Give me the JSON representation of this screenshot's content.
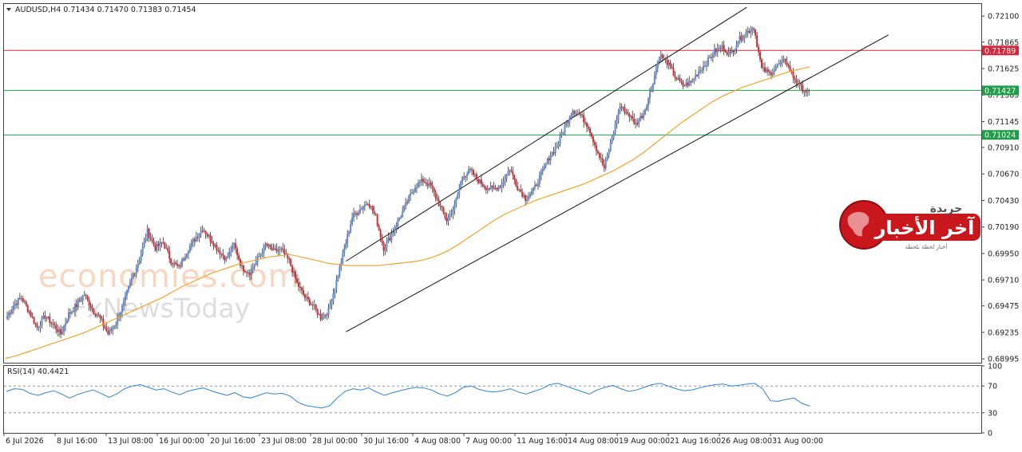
{
  "chart_data": {
    "type": "candlestick",
    "symbol_header": "AUDUSD,H4  0.71434 0.71470 0.71383 0.71454",
    "price_axis": {
      "ticks": [
        "0.72100",
        "0.71865",
        "0.71625",
        "0.71385",
        "0.71145",
        "0.70910",
        "0.70670",
        "0.70430",
        "0.70190",
        "0.69950",
        "0.69710",
        "0.69475",
        "0.69235",
        "0.68995"
      ],
      "range": [
        0.6896,
        0.7221
      ]
    },
    "time_axis": {
      "labels": [
        "6 Jul 2026",
        "8 Jul 16:00",
        "13 Jul 08:00",
        "16 Jul 00:00",
        "20 Jul 16:00",
        "23 Jul 08:00",
        "28 Jul 00:00",
        "30 Jul 16:00",
        "4 Aug 08:00",
        "7 Aug 00:00",
        "11 Aug 16:00",
        "14 Aug 08:00",
        "19 Aug 00:00",
        "21 Aug 16:00",
        "26 Aug 08:00",
        "31 Aug 00:00"
      ]
    },
    "horizontal_levels": [
      {
        "value": "0.71789",
        "color": "#d8263a"
      },
      {
        "value": "0.71427",
        "color": "#1e9e48"
      },
      {
        "value": "0.71024",
        "color": "#1e9e48"
      }
    ],
    "price_path": [
      0.6936,
      0.6948,
      0.6955,
      0.6942,
      0.6928,
      0.6938,
      0.6931,
      0.6922,
      0.694,
      0.6948,
      0.6958,
      0.6944,
      0.6936,
      0.6922,
      0.6932,
      0.695,
      0.6972,
      0.699,
      0.7015,
      0.7,
      0.7005,
      0.6988,
      0.6982,
      0.6997,
      0.7008,
      0.7018,
      0.7008,
      0.6998,
      0.699,
      0.7003,
      0.6982,
      0.6978,
      0.699,
      0.7003,
      0.6997,
      0.6998,
      0.6988,
      0.6968,
      0.6955,
      0.6948,
      0.6937,
      0.6943,
      0.697,
      0.6999,
      0.7028,
      0.7035,
      0.7042,
      0.7028,
      0.7,
      0.7012,
      0.7027,
      0.7042,
      0.7056,
      0.7061,
      0.7056,
      0.704,
      0.7025,
      0.7038,
      0.7065,
      0.707,
      0.7061,
      0.7055,
      0.7053,
      0.7058,
      0.7072,
      0.7055,
      0.7045,
      0.7052,
      0.7067,
      0.7082,
      0.7092,
      0.711,
      0.7125,
      0.712,
      0.711,
      0.709,
      0.7072,
      0.71,
      0.7128,
      0.7122,
      0.7112,
      0.7122,
      0.7145,
      0.7175,
      0.7168,
      0.7155,
      0.7147,
      0.715,
      0.716,
      0.7168,
      0.7178,
      0.7182,
      0.7175,
      0.7188,
      0.7195,
      0.72,
      0.7162,
      0.7158,
      0.7165,
      0.717,
      0.7155,
      0.7145,
      0.714
    ],
    "moving_average": [
      0.69,
      0.6902,
      0.6905,
      0.6908,
      0.6911,
      0.6914,
      0.6917,
      0.692,
      0.6923,
      0.6927,
      0.6931,
      0.6935,
      0.6939,
      0.6943,
      0.6947,
      0.6951,
      0.6955,
      0.696,
      0.6965,
      0.6969,
      0.6973,
      0.6977,
      0.698,
      0.6983,
      0.6986,
      0.6988,
      0.699,
      0.6992,
      0.6993,
      0.6994,
      0.6992,
      0.699,
      0.6988,
      0.6986,
      0.6985,
      0.6984,
      0.6984,
      0.6984,
      0.6984,
      0.6985,
      0.6986,
      0.6987,
      0.6988,
      0.699,
      0.6993,
      0.6997,
      0.7002,
      0.7008,
      0.7014,
      0.702,
      0.7026,
      0.7031,
      0.7035,
      0.7039,
      0.7043,
      0.7046,
      0.7049,
      0.7052,
      0.7055,
      0.7058,
      0.7062,
      0.7066,
      0.707,
      0.7075,
      0.708,
      0.7086,
      0.7093,
      0.71,
      0.7107,
      0.7114,
      0.712,
      0.7126,
      0.7132,
      0.7137,
      0.7141,
      0.7145,
      0.7148,
      0.7151,
      0.7154,
      0.7157,
      0.716,
      0.7162,
      0.7164
    ],
    "channel": {
      "upper": {
        "from": [
          0.35,
          0.6988
        ],
        "to": [
          0.76,
          0.7218
        ]
      },
      "lower": {
        "from": [
          0.35,
          0.6924
        ],
        "to": [
          0.905,
          0.7193
        ]
      }
    },
    "rsi": {
      "label": "RSI(14) 40.4421",
      "axis_ticks": [
        "100",
        "70",
        "30",
        "0"
      ],
      "levels": [
        70,
        30
      ],
      "values": [
        62,
        66,
        65,
        59,
        56,
        60,
        63,
        58,
        52,
        57,
        61,
        64,
        59,
        53,
        58,
        66,
        70,
        72,
        68,
        64,
        66,
        61,
        57,
        62,
        65,
        67,
        63,
        59,
        56,
        60,
        54,
        52,
        56,
        60,
        58,
        59,
        55,
        46,
        41,
        39,
        37,
        40,
        52,
        62,
        66,
        64,
        67,
        61,
        56,
        60,
        63,
        66,
        68,
        67,
        64,
        58,
        55,
        60,
        68,
        70,
        65,
        62,
        61,
        63,
        66,
        61,
        58,
        62,
        66,
        72,
        74,
        70,
        66,
        62,
        58,
        64,
        68,
        71,
        66,
        62,
        64,
        68,
        72,
        74,
        70,
        66,
        63,
        64,
        67,
        70,
        72,
        73,
        70,
        71,
        73,
        74,
        66,
        48,
        47,
        50,
        52,
        44,
        40
      ]
    },
    "watermark": {
      "line1": "economies.com",
      "line2": "FxNewsToday"
    },
    "logo": {
      "top": "جريدة",
      "main": "آخر الأخبار",
      "sub": "أخبار لحظة بلحظة"
    }
  }
}
